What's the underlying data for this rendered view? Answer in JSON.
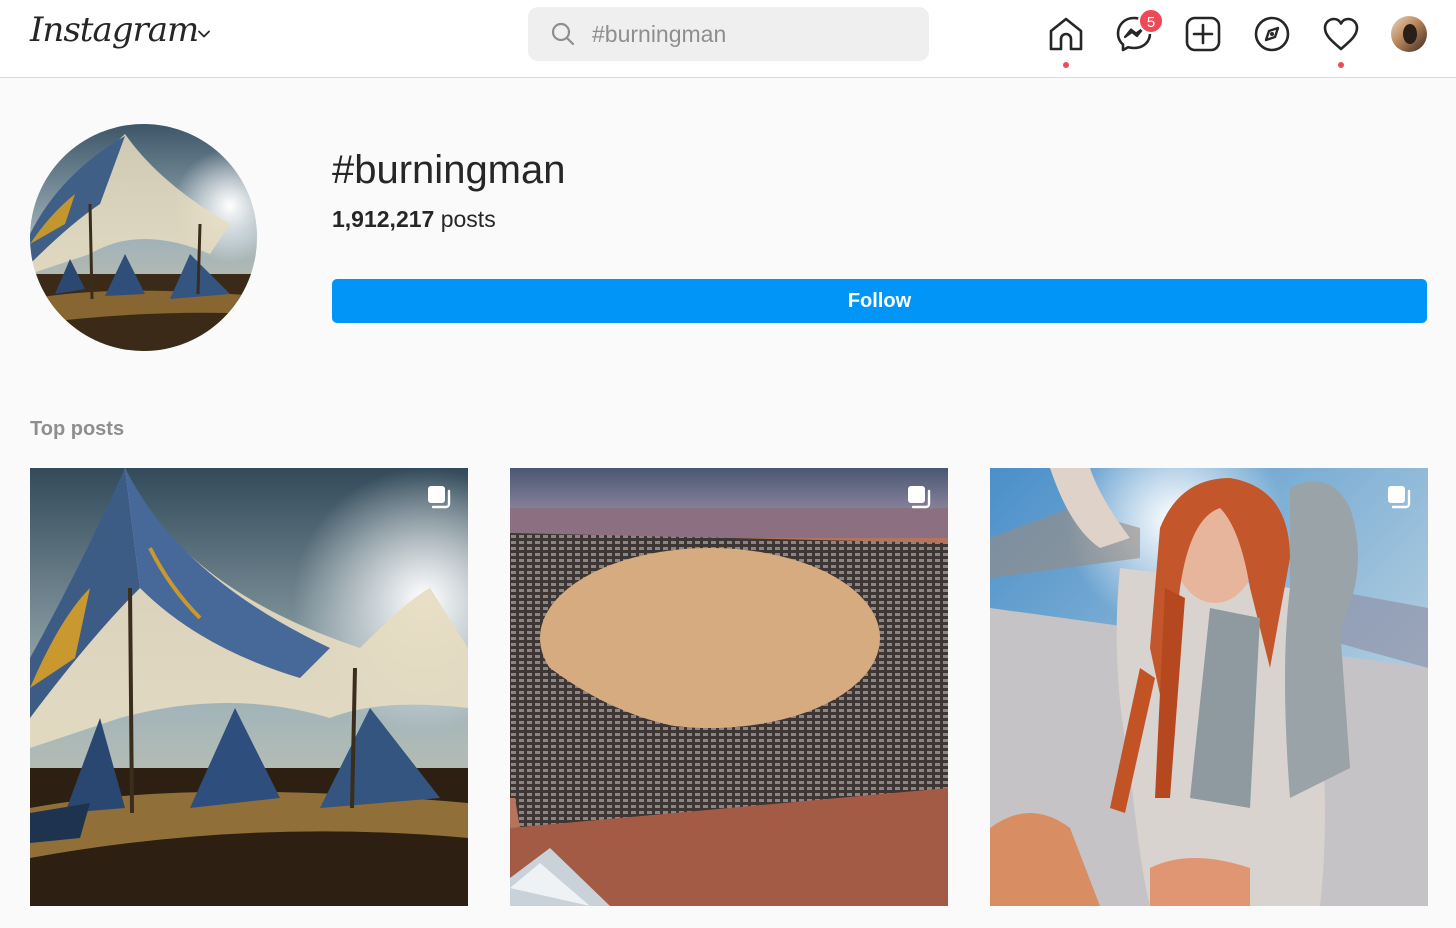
{
  "header": {
    "logo_text": "Instagram",
    "search": {
      "value": "#burningman",
      "placeholder": "Search"
    },
    "messenger_badge": "5",
    "icons": [
      "home-icon",
      "messenger-icon",
      "new-post-icon",
      "explore-icon",
      "activity-heart-icon",
      "profile-avatar"
    ]
  },
  "tag": {
    "name": "#burningman",
    "post_count": "1,912,217",
    "post_label": " posts",
    "follow_label": "Follow"
  },
  "top_posts": {
    "title": "Top posts",
    "posts": [
      {
        "kind": "image-carousel",
        "subject": "blue and gold desert tents"
      },
      {
        "kind": "image-carousel",
        "subject": "aerial view of Black Rock City"
      },
      {
        "kind": "image-carousel",
        "subject": "woman with red dreadlocks on playa"
      }
    ]
  },
  "colors": {
    "accent": "#0095f6",
    "notification": "#ed4956",
    "background": "#fafafa",
    "border": "#dbdbdb",
    "muted_text": "#8e8e8e"
  }
}
